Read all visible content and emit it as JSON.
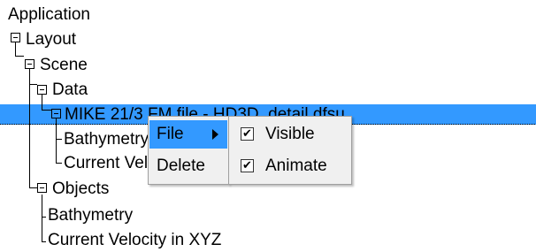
{
  "tree": {
    "application": "Application",
    "layout": "Layout",
    "scene": "Scene",
    "data": "Data",
    "dataset": "MIKE 21/3 FM file - HD3D_detail.dfsu",
    "data_child_1": "Bathymetry",
    "data_child_2": "Current Velocity in XYZ",
    "objects": "Objects",
    "objects_child_1": "Bathymetry",
    "objects_child_2": "Current Velocity in XYZ"
  },
  "context_menu": {
    "file": "File",
    "delete": "Delete"
  },
  "file_submenu": {
    "visible": {
      "label": "Visible",
      "checked": true
    },
    "animate": {
      "label": "Animate",
      "checked": true
    }
  },
  "checkmark": "✔",
  "colors": {
    "selection": "#3399ff",
    "menu_bg": "#f0f0f0",
    "menu_border": "#a0a0a0"
  }
}
